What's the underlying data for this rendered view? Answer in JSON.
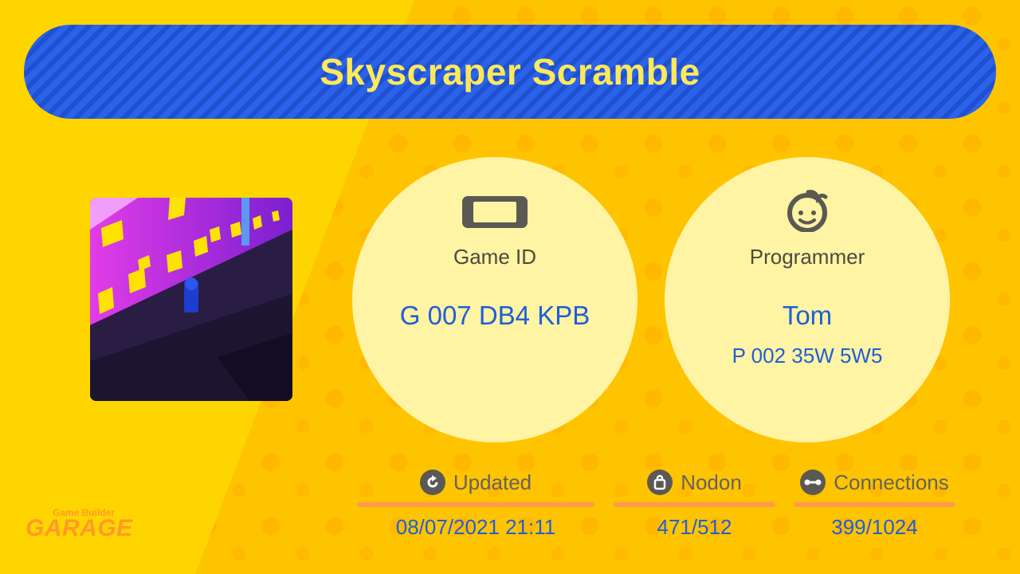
{
  "title": "Skyscraper Scramble",
  "game_id": {
    "label": "Game ID",
    "value": "G 007 DB4 KPB"
  },
  "programmer": {
    "label": "Programmer",
    "name": "Tom",
    "id": "P 002 35W 5W5"
  },
  "stats": {
    "updated": {
      "label": "Updated",
      "value": "08/07/2021 21:11"
    },
    "nodon": {
      "label": "Nodon",
      "value": "471/512"
    },
    "connections": {
      "label": "Connections",
      "value": "399/1024"
    }
  },
  "logo": {
    "line1": "Game Builder",
    "line2": "GARAGE"
  },
  "colors": {
    "background": "#ffd500",
    "title_bar": "#2a63ea",
    "title_text": "#ffe95a",
    "circle": "#fff3a4",
    "value_text": "#1f5fd6",
    "accent_line": "#ff9a4d"
  },
  "icons": {
    "game_id": "console-icon",
    "programmer": "face-icon",
    "updated": "refresh-icon",
    "nodon": "bag-icon",
    "connections": "connection-icon"
  }
}
